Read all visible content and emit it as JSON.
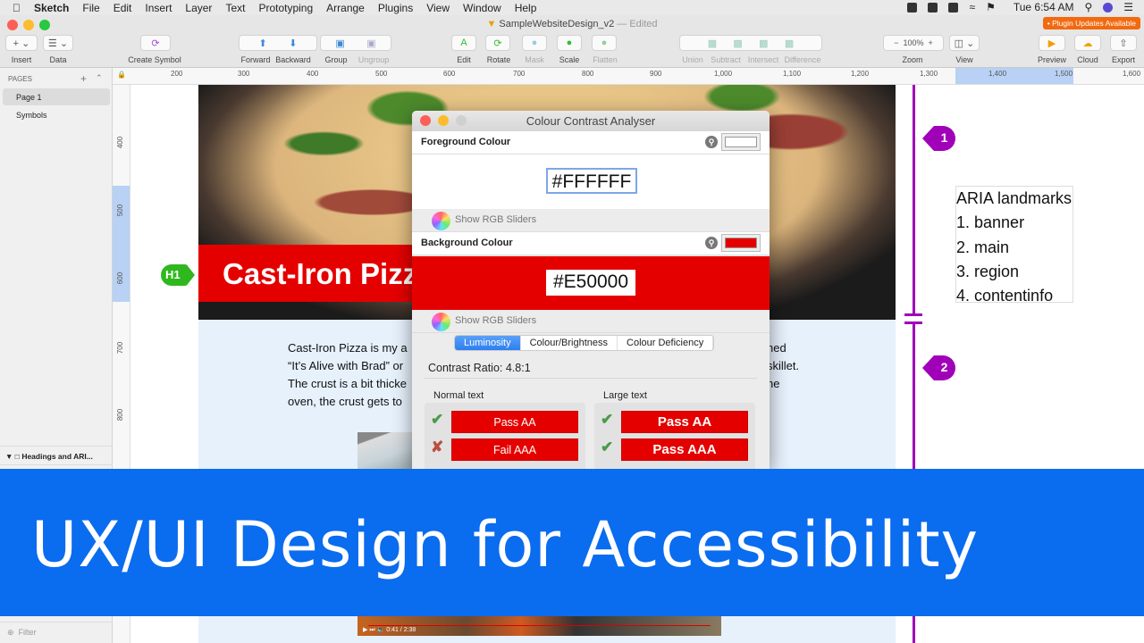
{
  "menubar": {
    "app": "Sketch",
    "items": [
      "File",
      "Edit",
      "Insert",
      "Layer",
      "Text",
      "Prototyping",
      "Arrange",
      "Plugins",
      "View",
      "Window",
      "Help"
    ],
    "clock": "Tue 6:54 AM"
  },
  "window": {
    "title": "SampleWebsiteDesign_v2",
    "status": "— Edited",
    "plugin_badge": "• Plugin Updates Available"
  },
  "toolbar": {
    "insert": "Insert",
    "data": "Data",
    "create_symbol": "Create Symbol",
    "forward": "Forward",
    "backward": "Backward",
    "group": "Group",
    "ungroup": "Ungroup",
    "edit": "Edit",
    "rotate": "Rotate",
    "mask": "Mask",
    "scale": "Scale",
    "flatten": "Flatten",
    "union": "Union",
    "subtract": "Subtract",
    "intersect": "Intersect",
    "difference": "Difference",
    "zoom_label": "Zoom",
    "zoom_value": "100%",
    "view": "View",
    "preview": "Preview",
    "cloud": "Cloud",
    "export": "Export"
  },
  "ruler": {
    "h": [
      "200",
      "300",
      "400",
      "500",
      "600",
      "700",
      "800",
      "900",
      "1,000",
      "1,100",
      "1,200",
      "1,300",
      "1,400",
      "1,500",
      "1,600"
    ],
    "v": [
      "400",
      "500",
      "600",
      "700",
      "800"
    ]
  },
  "sidebar": {
    "pages_label": "PAGES",
    "pages": [
      "Page 1",
      "Symbols"
    ],
    "layer": "Headings and ARI...",
    "filter": "Filter"
  },
  "artboard": {
    "heading": "Cast-Iron Pizza",
    "h1_badge": "H1",
    "body_lines": [
      "Cast-Iron Pizza is my a",
      "“It’s Alive with Brad” or",
      "The crust is a bit thicke",
      "oven, the crust gets to"
    ],
    "body_right": [
      "ned",
      "skillet.",
      "he",
      ""
    ],
    "video_time": "0:41 / 2:38"
  },
  "landmarks": {
    "pins": [
      "1",
      "2"
    ],
    "title": "ARIA landmarks",
    "items": [
      "1. banner",
      "2. main",
      "3. region",
      "4. contentinfo"
    ],
    "color": "#A000B8"
  },
  "dialog": {
    "title": "Colour Contrast Analyser",
    "foreground_label": "Foreground Colour",
    "foreground_hex": "#FFFFFF",
    "background_label": "Background Colour",
    "background_hex": "#E50000",
    "rgb_sliders": "Show RGB Sliders",
    "tabs": [
      "Luminosity",
      "Colour/Brightness",
      "Colour Deficiency"
    ],
    "active_tab": "Luminosity",
    "contrast_ratio": "Contrast Ratio: 4.8:1",
    "normal_label": "Normal text",
    "large_label": "Large text",
    "normal": [
      {
        "label": "Pass AA",
        "pass": true
      },
      {
        "label": "Fail AAA",
        "pass": false
      }
    ],
    "large": [
      {
        "label": "Pass AA",
        "pass": true
      },
      {
        "label": "Pass AAA",
        "pass": true
      }
    ]
  },
  "banner": {
    "text": "UX/UI Design for Accessibility",
    "color": "#0A6CEF"
  }
}
